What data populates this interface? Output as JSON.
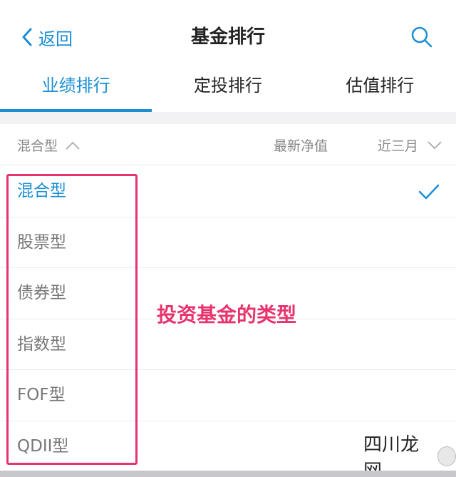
{
  "nav": {
    "back_label": "返回",
    "title": "基金排行"
  },
  "tabs": [
    {
      "label": "业绩排行",
      "active": true
    },
    {
      "label": "定投排行",
      "active": false
    },
    {
      "label": "估值排行",
      "active": false
    }
  ],
  "filter": {
    "type_label": "混合型",
    "nav_label": "最新净值",
    "period_label": "近三月"
  },
  "options": [
    {
      "label": "混合型",
      "selected": true
    },
    {
      "label": "股票型",
      "selected": false
    },
    {
      "label": "债券型",
      "selected": false
    },
    {
      "label": "指数型",
      "selected": false
    },
    {
      "label": "FOF型",
      "selected": false
    },
    {
      "label": "QDII型",
      "selected": false
    }
  ],
  "annotation": "投资基金的类型",
  "watermark": "四川龙网",
  "colors": {
    "accent": "#1a8fd4",
    "annotation": "#e8336d"
  },
  "icons": {
    "back": "chevron-left-icon",
    "search": "search-icon",
    "sort_up": "chevron-up-icon",
    "sort_down": "chevron-down-icon",
    "selected": "check-icon"
  }
}
